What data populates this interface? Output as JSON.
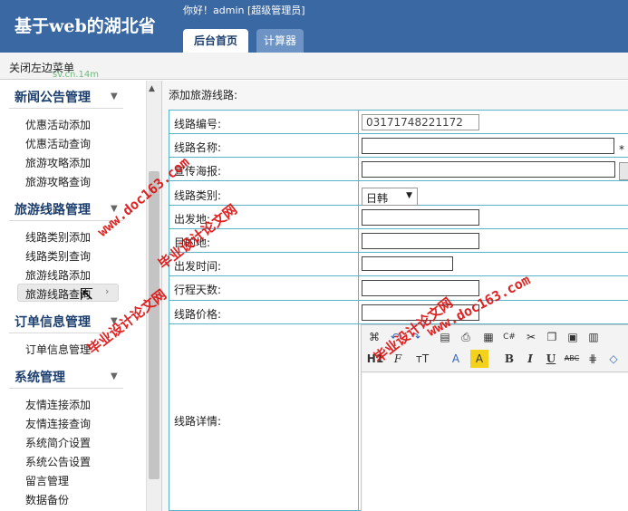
{
  "header": {
    "app_title": "基于web的湖北省",
    "greeting": "你好！admin [超级管理员]",
    "tabs": [
      {
        "label": "后台首页"
      },
      {
        "label": "计算器"
      }
    ]
  },
  "subbar": {
    "close_menu": "关闭左边菜单",
    "faint_text": "sv.cn.14m"
  },
  "sidebar": {
    "groups": [
      {
        "title": "新闻公告管理",
        "items": [
          "优惠活动添加",
          "优惠活动查询",
          "旅游攻略添加",
          "旅游攻略查询"
        ]
      },
      {
        "title": "旅游线路管理",
        "items": [
          "线路类别添加",
          "线路类别查询",
          "旅游线路添加",
          "旅游线路查询"
        ]
      },
      {
        "title": "订单信息管理",
        "items": [
          "订单信息管理"
        ]
      },
      {
        "title": "系统管理",
        "items": [
          "友情连接添加",
          "友情连接查询",
          "系统简介设置",
          "系统公告设置",
          "留言管理",
          "数据备份"
        ]
      }
    ],
    "active_item": "旅游线路查询"
  },
  "form": {
    "caption": "添加旅游线路:",
    "fields": {
      "code": {
        "label": "线路编号:",
        "value": "03171748221172"
      },
      "name": {
        "label": "线路名称:",
        "value": "",
        "required_mark": "*"
      },
      "poster": {
        "label": "宣传海报:",
        "value": ""
      },
      "type": {
        "label": "线路类别:",
        "value": "日韩"
      },
      "origin": {
        "label": "出发地:",
        "value": ""
      },
      "dest": {
        "label": "目的地:",
        "value": ""
      },
      "depart": {
        "label": "出发时间:",
        "value": ""
      },
      "days": {
        "label": "行程天数:",
        "value": ""
      },
      "price": {
        "label": "线路价格:",
        "value": ""
      },
      "detail": {
        "label": "线路详情:"
      }
    }
  },
  "editor_toolbar": {
    "icons_row1": [
      "source-icon",
      "undo-icon",
      "redo-icon",
      "preview-icon",
      "print-icon",
      "template-icon",
      "code-icon",
      "cut-icon",
      "copy-icon",
      "paste-icon",
      "paste-text-icon"
    ],
    "icons_row2": [
      "heading-icon",
      "font-family-icon",
      "font-size-icon",
      "font-color-icon",
      "background-color-icon",
      "bold-icon",
      "italic-icon",
      "underline-icon",
      "strikethrough-icon",
      "table-icon",
      "eraser-icon"
    ],
    "heading": "H1",
    "font_family": "F",
    "font_size": "тT",
    "bold": "B",
    "italic": "I",
    "underline": "U",
    "strikethrough": "ABC",
    "highlight_color": "#f4d11a"
  },
  "watermarks": [
    {
      "line1": "毕业设计论文网",
      "line2": "www.doc163.com"
    }
  ]
}
